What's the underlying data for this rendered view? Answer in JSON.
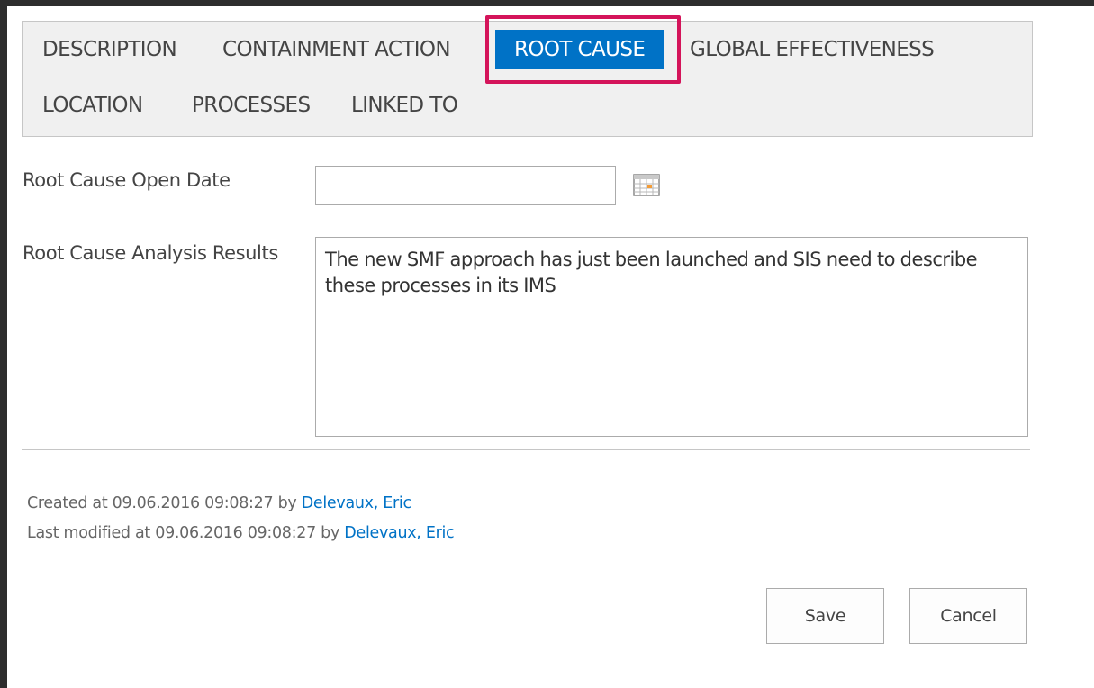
{
  "tabs": [
    {
      "label": "DESCRIPTION",
      "active": false
    },
    {
      "label": "CONTAINMENT ACTION",
      "active": false
    },
    {
      "label": "ROOT CAUSE",
      "active": true
    },
    {
      "label": "GLOBAL EFFECTIVENESS",
      "active": false
    },
    {
      "label": "LOCATION",
      "active": false
    },
    {
      "label": "PROCESSES",
      "active": false
    },
    {
      "label": "LINKED TO",
      "active": false
    }
  ],
  "form": {
    "open_date_label": "Root Cause Open Date",
    "open_date_value": "",
    "results_label": "Root Cause Analysis Results",
    "results_value": "The new SMF approach has just been launched and SIS need to describe these processes in its IMS"
  },
  "meta": {
    "created_prefix": "Created at 09.06.2016 09:08:27 by ",
    "created_by": "Delevaux, Eric",
    "modified_prefix": "Last modified at 09.06.2016 09:08:27 by ",
    "modified_by": "Delevaux, Eric"
  },
  "buttons": {
    "save": "Save",
    "cancel": "Cancel"
  },
  "colors": {
    "accent": "#0072c6",
    "highlight": "#d4145a",
    "tabbar_bg": "#f0f0f0"
  },
  "icons": {
    "calendar": "calendar-icon"
  }
}
